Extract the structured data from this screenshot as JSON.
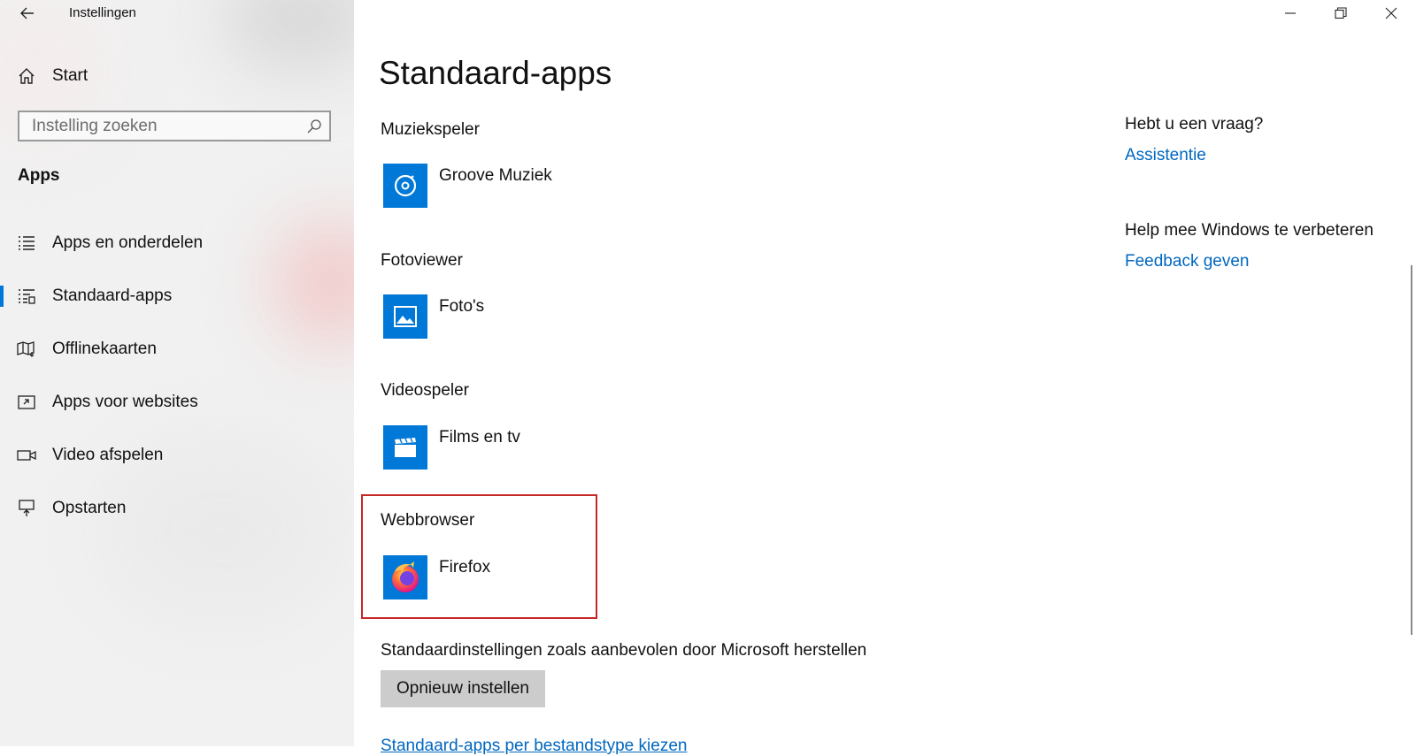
{
  "window": {
    "title": "Instellingen",
    "controls": {
      "minimize": "minimize-icon",
      "restore": "restore-icon",
      "close": "close-icon"
    }
  },
  "sidebar": {
    "home_label": "Start",
    "search_placeholder": "Instelling zoeken",
    "section_title": "Apps",
    "items": [
      {
        "label": "Apps en onderdelen",
        "icon": "apps-list-icon"
      },
      {
        "label": "Standaard-apps",
        "icon": "default-apps-icon",
        "active": true
      },
      {
        "label": "Offlinekaarten",
        "icon": "offline-map-icon"
      },
      {
        "label": "Apps voor websites",
        "icon": "apps-websites-icon"
      },
      {
        "label": "Video afspelen",
        "icon": "video-icon"
      },
      {
        "label": "Opstarten",
        "icon": "startup-icon"
      }
    ]
  },
  "main": {
    "title": "Standaard-apps",
    "categories": [
      {
        "label": "Muziekspeler",
        "app": "Groove Muziek",
        "icon": "groove-music-icon"
      },
      {
        "label": "Fotoviewer",
        "app": "Foto's",
        "icon": "photos-icon"
      },
      {
        "label": "Videospeler",
        "app": "Films en tv",
        "icon": "films-tv-icon"
      },
      {
        "label": "Webbrowser",
        "app": "Firefox",
        "icon": "firefox-icon"
      }
    ],
    "reset_text": "Standaardinstellingen zoals aanbevolen door Microsoft herstellen",
    "reset_button": "Opnieuw instellen",
    "file_type_link": "Standaard-apps per bestandstype kiezen"
  },
  "help": {
    "question": "Hebt u een vraag?",
    "assist_link": "Assistentie",
    "improve_title": "Help mee Windows te verbeteren",
    "feedback_link": "Feedback geven"
  },
  "colors": {
    "accent": "#0078d7",
    "link": "#0067c0",
    "highlight_box": "#c62828",
    "button_bg": "#cccccc"
  }
}
